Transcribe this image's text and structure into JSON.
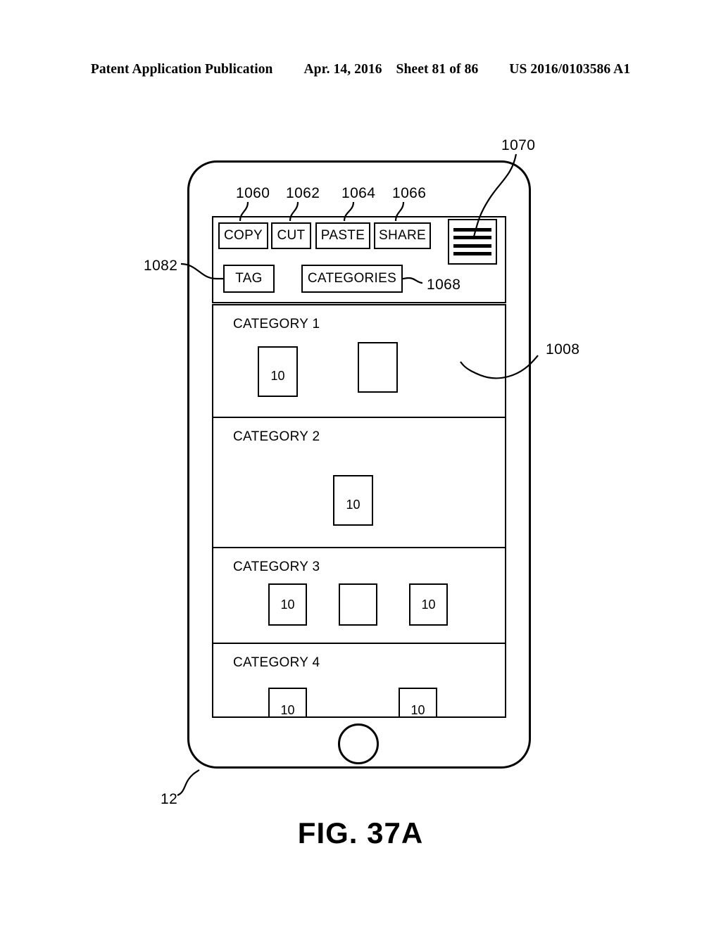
{
  "header": {
    "publication": "Patent Application Publication",
    "date": "Apr. 14, 2016",
    "sheet": "Sheet 81 of 86",
    "patent_number": "US 2016/0103586 A1"
  },
  "figure": {
    "caption": "FIG. 37A"
  },
  "device": {
    "ref": "12",
    "home_button": "home-button"
  },
  "toolbar": {
    "ref_panel": "1082",
    "buttons": [
      {
        "label": "COPY",
        "ref": "1060"
      },
      {
        "label": "CUT",
        "ref": "1062"
      },
      {
        "label": "PASTE",
        "ref": "1064"
      },
      {
        "label": "SHARE",
        "ref": "1066"
      }
    ],
    "tag": {
      "label": "TAG",
      "ref": "1082"
    },
    "categories": {
      "label": "CATEGORIES",
      "ref": "1068"
    },
    "menu": {
      "icon": "hamburger-menu-icon",
      "ref": "1070",
      "bars": 4
    }
  },
  "category_list": {
    "ref": "1008",
    "rows": [
      {
        "title": "CATEGORY 1",
        "items": [
          {
            "label": "10"
          },
          {
            "label": ""
          }
        ]
      },
      {
        "title": "CATEGORY 2",
        "items": [
          {
            "label": "10"
          }
        ]
      },
      {
        "title": "CATEGORY 3",
        "items": [
          {
            "label": "10"
          },
          {
            "label": ""
          },
          {
            "label": "10"
          }
        ]
      },
      {
        "title": "CATEGORY 4",
        "items": [
          {
            "label": "10"
          },
          {
            "label": "10"
          }
        ]
      }
    ]
  },
  "colors": {
    "ink": "#000000",
    "paper": "#ffffff"
  }
}
